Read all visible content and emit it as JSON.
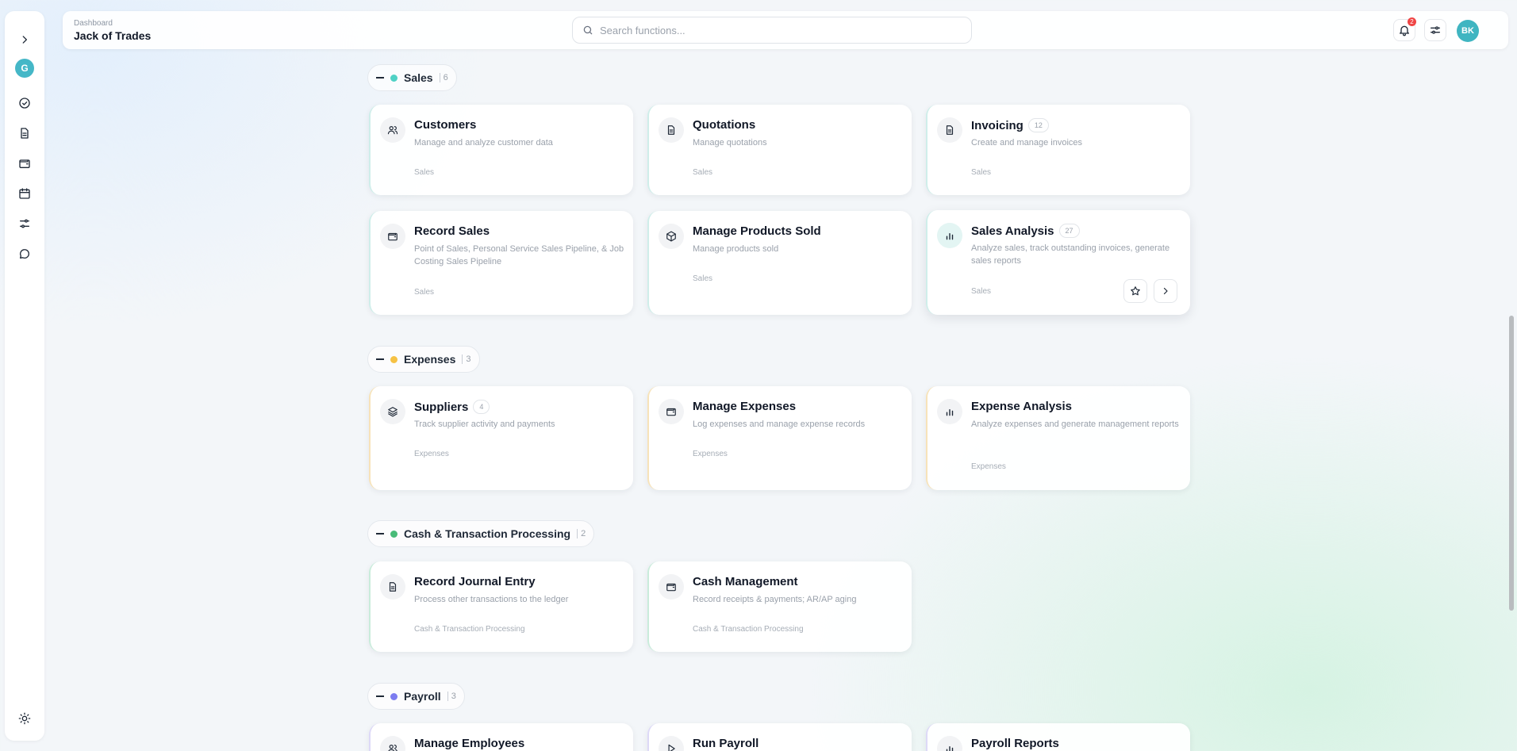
{
  "header": {
    "breadcrumb": "Dashboard",
    "app_title": "Jack of Trades",
    "search_placeholder": "Search functions...",
    "notification_count": "2",
    "user_initials": "BK"
  },
  "sidebar": {
    "avatar_letter": "G",
    "icons": [
      "chevron-right-icon",
      "check-circle-icon",
      "document-icon",
      "wallet-icon",
      "calendar-icon",
      "sliders-icon",
      "chat-icon",
      "sun-icon"
    ]
  },
  "sections": {
    "sales": {
      "name": "Sales",
      "count": "6",
      "color": "#4fd1c5"
    },
    "expenses": {
      "name": "Expenses",
      "count": "3",
      "color": "#f6c244"
    },
    "cash": {
      "name": "Cash & Transaction Processing",
      "count": "2",
      "color": "#48bb78"
    },
    "payroll": {
      "name": "Payroll",
      "count": "3",
      "color": "#7c7cf0"
    }
  },
  "cards": {
    "customers": {
      "title": "Customers",
      "desc": "Manage and analyze customer data",
      "category": "Sales"
    },
    "quotations": {
      "title": "Quotations",
      "desc": "Manage quotations",
      "category": "Sales"
    },
    "invoicing": {
      "title": "Invoicing",
      "badge": "12",
      "desc": "Create and manage invoices",
      "category": "Sales"
    },
    "record_sales": {
      "title": "Record Sales",
      "desc": "Point of Sales, Personal Service Sales Pipeline, & Job Costing Sales Pipeline",
      "category": "Sales"
    },
    "products_sold": {
      "title": "Manage Products Sold",
      "desc": "Manage products sold",
      "category": "Sales"
    },
    "sales_analysis": {
      "title": "Sales Analysis",
      "badge": "27",
      "desc": "Analyze sales, track outstanding invoices, generate sales reports",
      "category": "Sales"
    },
    "suppliers": {
      "title": "Suppliers",
      "badge": "4",
      "desc": "Track supplier activity and payments",
      "category": "Expenses"
    },
    "manage_expenses": {
      "title": "Manage Expenses",
      "desc": "Log expenses and manage expense records",
      "category": "Expenses"
    },
    "expense_analysis": {
      "title": "Expense Analysis",
      "desc": "Analyze expenses and generate management reports",
      "category": "Expenses"
    },
    "journal_entry": {
      "title": "Record Journal Entry",
      "desc": "Process other transactions to the ledger",
      "category": "Cash & Transaction Processing"
    },
    "cash_management": {
      "title": "Cash Management",
      "desc": "Record receipts & payments; AR/AP aging",
      "category": "Cash & Transaction Processing"
    },
    "manage_employees": {
      "title": "Manage Employees"
    },
    "run_payroll": {
      "title": "Run Payroll"
    },
    "payroll_reports": {
      "title": "Payroll Reports"
    }
  }
}
